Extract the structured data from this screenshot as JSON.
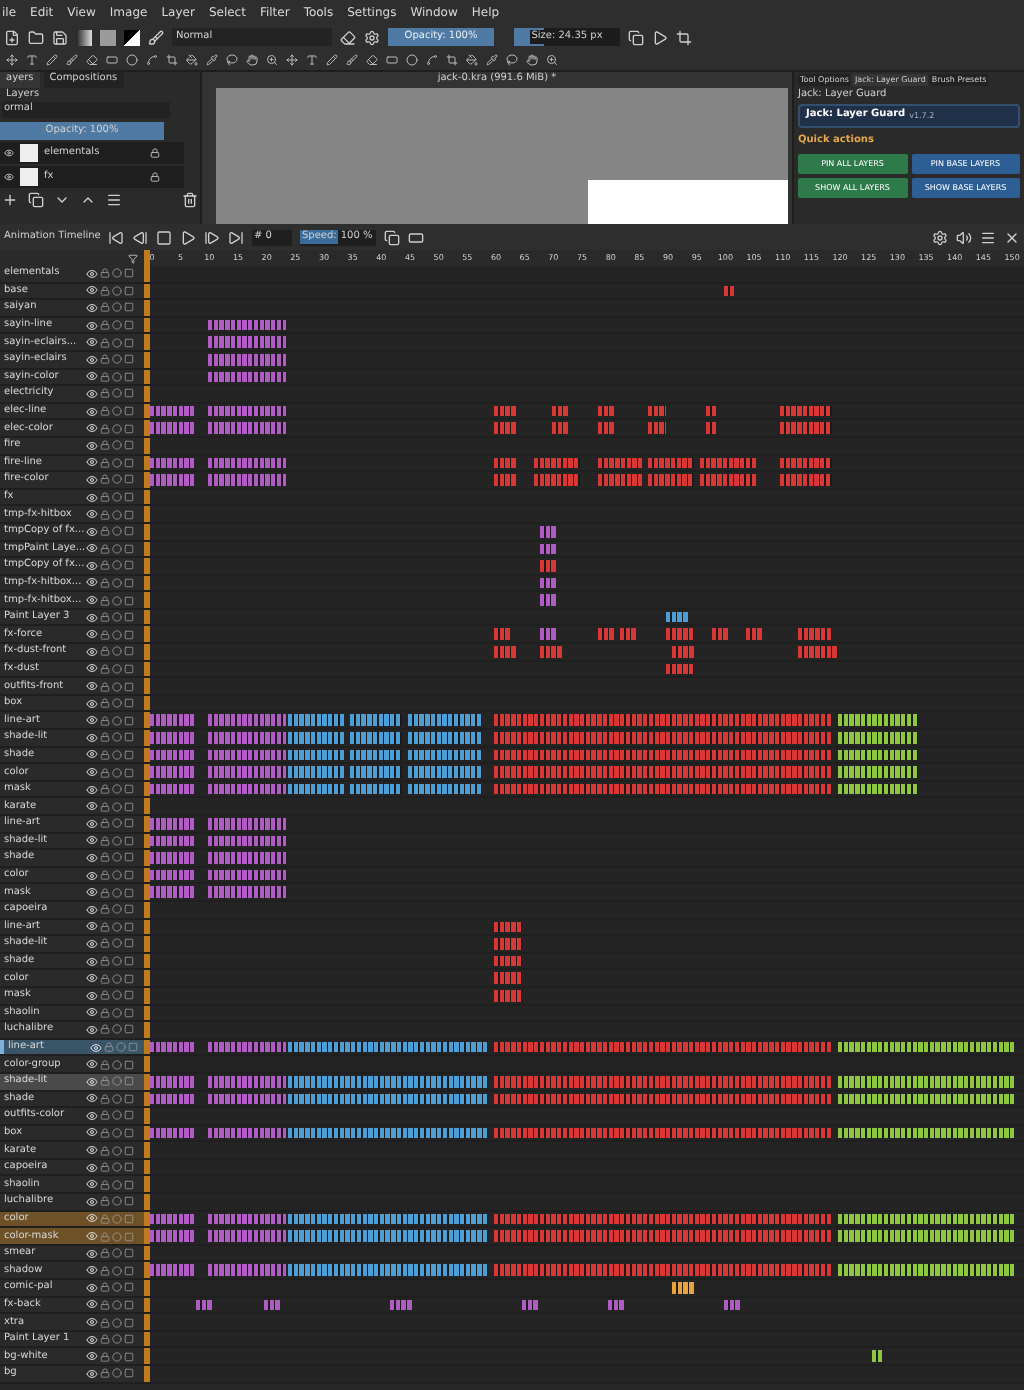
{
  "menu": [
    "ile",
    "Edit",
    "View",
    "Image",
    "Layer",
    "Select",
    "Filter",
    "Tools",
    "Settings",
    "Window",
    "Help"
  ],
  "toolbar": {
    "blend_mode": "Normal",
    "opacity": {
      "label": "Opacity: 100%",
      "level": 1
    },
    "size": {
      "label": "Size: 24.35 px",
      "level": 0.28
    }
  },
  "layers_docker": {
    "tabs": [
      {
        "label": "ayers",
        "selected": true
      },
      {
        "label": "Compositions",
        "selected": false
      }
    ],
    "title": "Layers",
    "blend_mode": "ormal",
    "opacity": {
      "label": "Opacity: 100%",
      "level": 1
    },
    "layers": [
      {
        "name": "elementals"
      },
      {
        "name": "fx"
      }
    ]
  },
  "document": {
    "title": "jack-0.kra (991.6 MiB) *"
  },
  "right_docker": {
    "tabs": [
      {
        "label": "Tool Options",
        "selected": false
      },
      {
        "label": "Jack: Layer Guard",
        "selected": true
      },
      {
        "label": "Brush Presets",
        "selected": false
      }
    ],
    "title": "Jack: Layer Guard",
    "plugin_name": "Jack: Layer Guard",
    "version": "v1.7.2",
    "section": "Quick actions",
    "buttons": [
      {
        "label": "PIN ALL LAYERS",
        "kind": "green"
      },
      {
        "label": "PIN BASE LAYERS",
        "kind": "blue"
      },
      {
        "label": "SHOW ALL LAYERS",
        "kind": "green"
      },
      {
        "label": "SHOW BASE LAYERS",
        "kind": "blue"
      }
    ]
  },
  "timeline": {
    "title": "Animation Timeline",
    "frame": "# 0",
    "speed_label": "Speed:",
    "speed": "100 %",
    "ruler": [
      "0",
      "5",
      "10",
      "15",
      "20",
      "25",
      "30",
      "35",
      "40",
      "45",
      "50",
      "55",
      "60",
      "65",
      "70",
      "75",
      "80",
      "85",
      "90",
      "95",
      "100",
      "105",
      "110",
      "115",
      "120",
      "125",
      "130",
      "135",
      "140",
      "145",
      "150"
    ],
    "rows": [
      {
        "name": "elementals",
        "selected": false,
        "current": false
      },
      {
        "name": "base",
        "selected": false,
        "current": false
      },
      {
        "name": "saiyan",
        "selected": false,
        "current": false
      },
      {
        "name": "sayin-line",
        "selected": false,
        "current": false
      },
      {
        "name": "sayin-eclairs...",
        "selected": false,
        "current": false
      },
      {
        "name": "sayin-eclairs",
        "selected": false,
        "current": false
      },
      {
        "name": "sayin-color",
        "selected": false,
        "current": false
      },
      {
        "name": "electricity",
        "selected": false,
        "current": false
      },
      {
        "name": "elec-line",
        "selected": false,
        "current": false
      },
      {
        "name": "elec-color",
        "selected": false,
        "current": false
      },
      {
        "name": "fire",
        "selected": false,
        "current": false
      },
      {
        "name": "fire-line",
        "selected": false,
        "current": false
      },
      {
        "name": "fire-color",
        "selected": false,
        "current": false
      },
      {
        "name": "fx",
        "selected": false,
        "current": false
      },
      {
        "name": "tmp-fx-hitbox",
        "selected": false,
        "current": false
      },
      {
        "name": "tmpCopy of fx...",
        "selected": false,
        "current": false
      },
      {
        "name": "tmpPaint Laye...",
        "selected": false,
        "current": false
      },
      {
        "name": "tmpCopy of fx...",
        "selected": false,
        "current": false
      },
      {
        "name": "tmp-fx-hitbox...",
        "selected": false,
        "current": false
      },
      {
        "name": "tmp-fx-hitbox...",
        "selected": false,
        "current": false
      },
      {
        "name": "Paint Layer 3",
        "selected": false,
        "current": false
      },
      {
        "name": "fx-force",
        "selected": false,
        "current": false
      },
      {
        "name": "fx-dust-front",
        "selected": false,
        "current": false
      },
      {
        "name": "fx-dust",
        "selected": false,
        "current": false
      },
      {
        "name": "outfits-front",
        "selected": false,
        "current": false
      },
      {
        "name": "box",
        "selected": false,
        "current": false
      },
      {
        "name": "line-art",
        "selected": false,
        "current": false
      },
      {
        "name": "shade-lit",
        "selected": false,
        "current": false
      },
      {
        "name": "shade",
        "selected": false,
        "current": false
      },
      {
        "name": "color",
        "selected": false,
        "current": false
      },
      {
        "name": "mask",
        "selected": false,
        "current": false
      },
      {
        "name": "karate",
        "selected": false,
        "current": false
      },
      {
        "name": "line-art",
        "selected": false,
        "current": false
      },
      {
        "name": "shade-lit",
        "selected": false,
        "current": false
      },
      {
        "name": "shade",
        "selected": false,
        "current": false
      },
      {
        "name": "color",
        "selected": false,
        "current": false
      },
      {
        "name": "mask",
        "selected": false,
        "current": false
      },
      {
        "name": "capoeira",
        "selected": false,
        "current": false
      },
      {
        "name": "line-art",
        "selected": false,
        "current": false
      },
      {
        "name": "shade-lit",
        "selected": false,
        "current": false
      },
      {
        "name": "shade",
        "selected": false,
        "current": false
      },
      {
        "name": "color",
        "selected": false,
        "current": false
      },
      {
        "name": "mask",
        "selected": false,
        "current": false
      },
      {
        "name": "shaolin",
        "selected": false,
        "current": false
      },
      {
        "name": "luchalibre",
        "selected": false,
        "current": false
      },
      {
        "name": "line-art",
        "selected": true,
        "current": true
      },
      {
        "name": "color-group",
        "selected": false,
        "current": false
      },
      {
        "name": "shade-lit",
        "selected": true,
        "current": false
      },
      {
        "name": "shade",
        "selected": false,
        "current": false
      },
      {
        "name": "outfits-color",
        "selected": false,
        "current": false
      },
      {
        "name": "box",
        "selected": false,
        "current": false
      },
      {
        "name": "karate",
        "selected": false,
        "current": false
      },
      {
        "name": "capoeira",
        "selected": false,
        "current": false
      },
      {
        "name": "shaolin",
        "selected": false,
        "current": false
      },
      {
        "name": "luchalibre",
        "selected": false,
        "current": false
      },
      {
        "name": "color",
        "selected": false,
        "current": false,
        "color": "#6e5126"
      },
      {
        "name": "color-mask",
        "selected": false,
        "current": false,
        "color": "#6e5126"
      },
      {
        "name": "smear",
        "selected": false,
        "current": false
      },
      {
        "name": "shadow",
        "selected": false,
        "current": false
      },
      {
        "name": "comic-pal",
        "selected": false,
        "current": false
      },
      {
        "name": "fx-back",
        "selected": false,
        "current": false
      },
      {
        "name": "xtra",
        "selected": false,
        "current": false
      },
      {
        "name": "Paint Layer 1",
        "selected": false,
        "current": false
      },
      {
        "name": "bg-white",
        "selected": false,
        "current": false
      },
      {
        "name": "bg",
        "selected": false,
        "current": false
      }
    ]
  }
}
